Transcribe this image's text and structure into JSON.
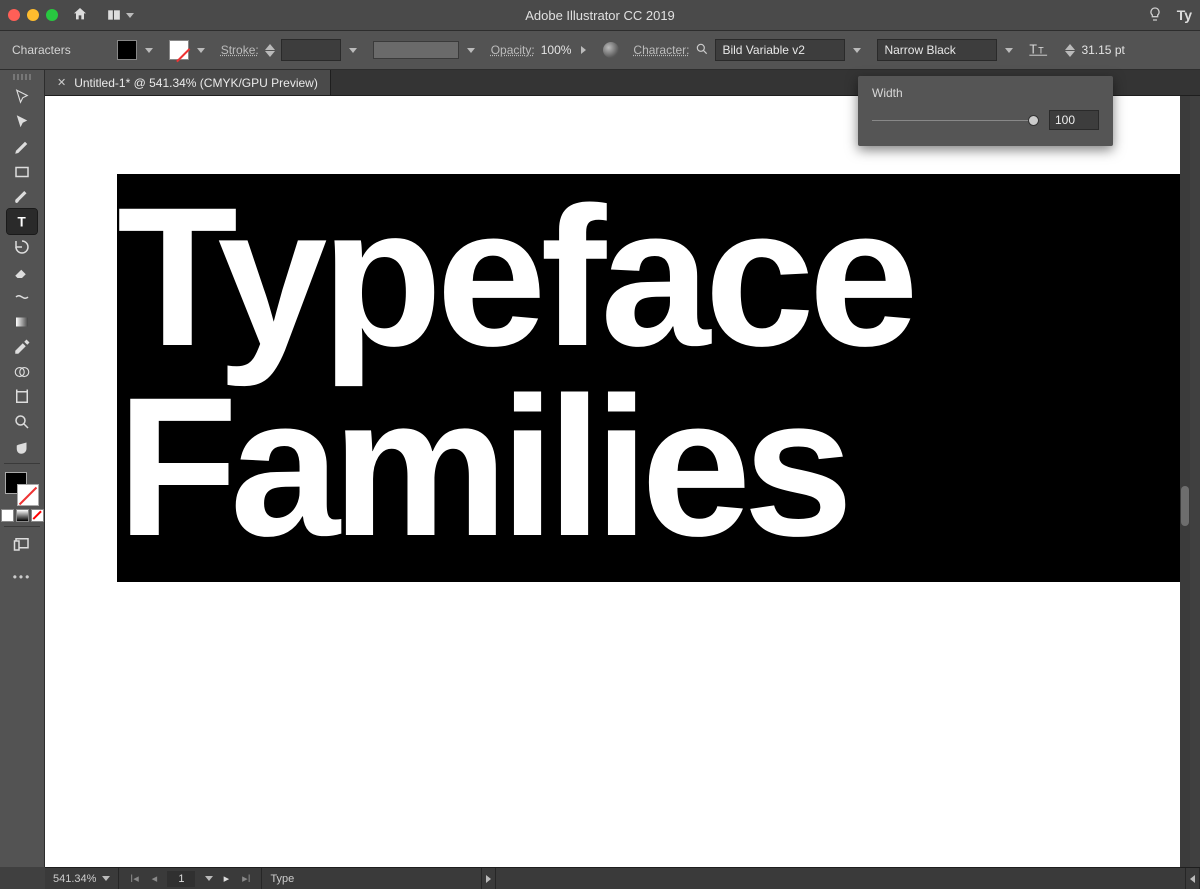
{
  "app": {
    "title": "Adobe Illustrator CC 2019",
    "right_label": "Ty"
  },
  "control": {
    "mode_label": "Characters",
    "stroke_label": "Stroke:",
    "opacity_label": "Opacity:",
    "opacity_value": "100%",
    "character_label": "Character:",
    "font_family": "Bild Variable v2",
    "font_style": "Narrow Black",
    "font_size": "31.15 pt"
  },
  "tab": {
    "title": "Untitled-1* @ 541.34% (CMYK/GPU Preview)"
  },
  "panel": {
    "width_label": "Width",
    "width_value": "100"
  },
  "canvas": {
    "line1": "Typeface",
    "line2": "Families"
  },
  "status": {
    "zoom": "541.34%",
    "page": "1",
    "tool": "Type"
  }
}
